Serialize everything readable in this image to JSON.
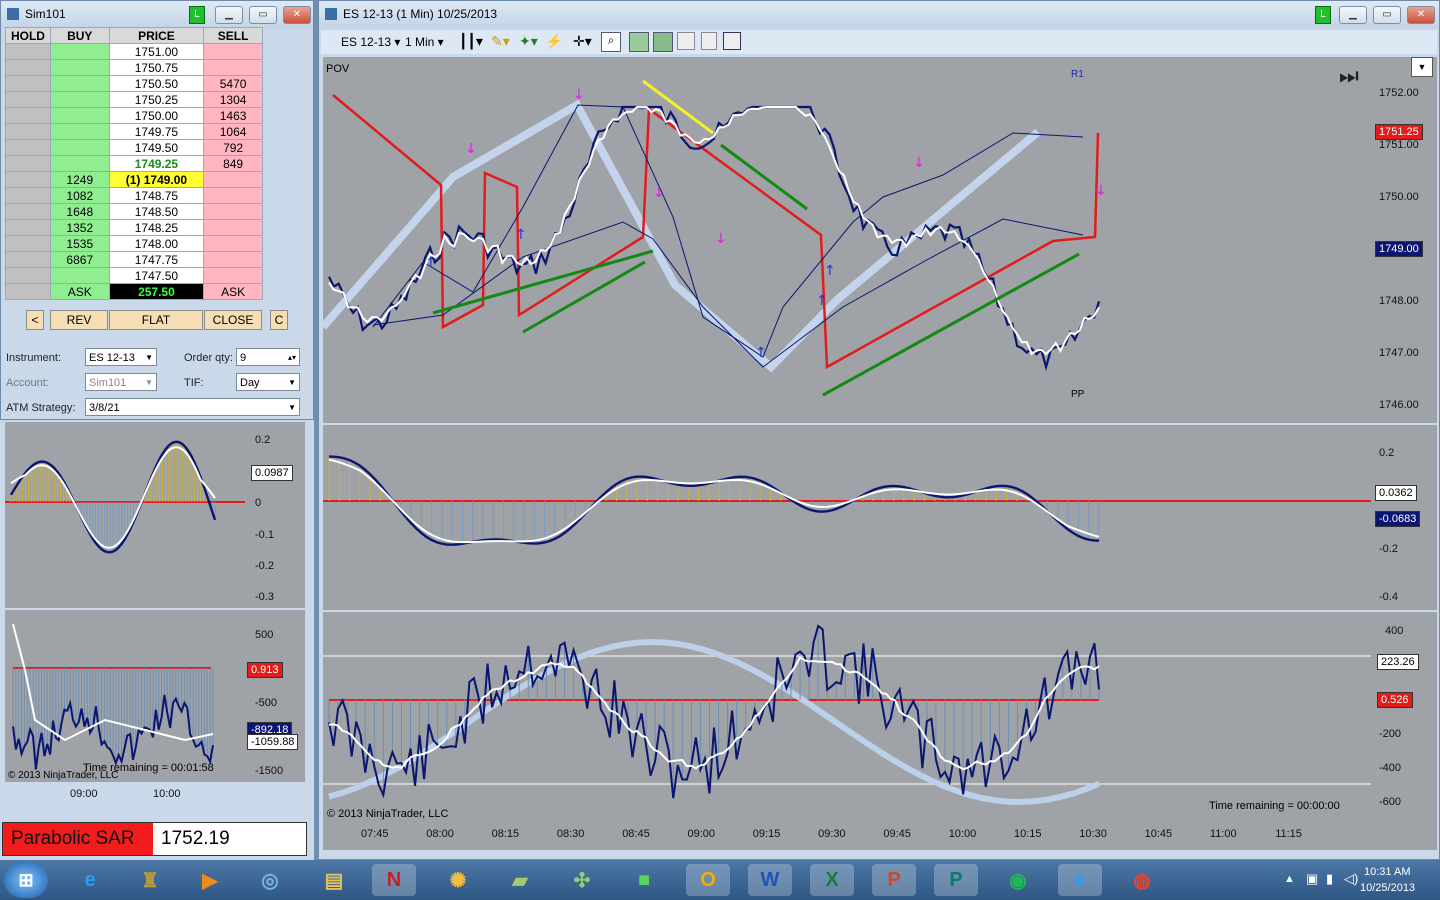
{
  "dom": {
    "title": "Sim101",
    "status_badge": "L",
    "headers": [
      "HOLD",
      "BUY",
      "PRICE",
      "SELL"
    ],
    "rows": [
      {
        "buy": "",
        "price": "1751.00",
        "sell": ""
      },
      {
        "buy": "",
        "price": "1750.75",
        "sell": ""
      },
      {
        "buy": "",
        "price": "1750.50",
        "sell": "5470"
      },
      {
        "buy": "",
        "price": "1750.25",
        "sell": "1304"
      },
      {
        "buy": "",
        "price": "1750.00",
        "sell": "1463"
      },
      {
        "buy": "",
        "price": "1749.75",
        "sell": "1064"
      },
      {
        "buy": "",
        "price": "1749.50",
        "sell": "792"
      },
      {
        "buy": "",
        "price": "1749.25",
        "sell": "849"
      },
      {
        "buy": "1249",
        "price": "(1) 1749.00",
        "sell": ""
      },
      {
        "buy": "1082",
        "price": "1748.75",
        "sell": ""
      },
      {
        "buy": "1648",
        "price": "1748.50",
        "sell": ""
      },
      {
        "buy": "1352",
        "price": "1748.25",
        "sell": ""
      },
      {
        "buy": "1535",
        "price": "1748.00",
        "sell": ""
      },
      {
        "buy": "6867",
        "price": "1747.75",
        "sell": ""
      },
      {
        "buy": "",
        "price": "1747.50",
        "sell": ""
      }
    ],
    "footer": {
      "left": "ASK",
      "mid": "257.50",
      "right": "ASK"
    },
    "buttons": {
      "back": "<",
      "rev": "REV",
      "flat": "FLAT",
      "close": "CLOSE",
      "c": "C"
    },
    "instrument_label": "Instrument:",
    "instrument_value": "ES 12-13",
    "order_qty_label": "Order qty:",
    "order_qty_value": "9",
    "account_label": "Account:",
    "account_value": "Sim101",
    "tif_label": "TIF:",
    "tif_value": "Day",
    "atm_label": "ATM Strategy:",
    "atm_value": "3/8/21"
  },
  "left_indicators": {
    "macd_ticks": [
      "0.2",
      "0.1",
      "0",
      "-0.1",
      "-0.2",
      "-0.3"
    ],
    "macd_tag": "0.0987",
    "osc_ticks": [
      "500",
      "-500",
      "-1500"
    ],
    "osc_tag_red": "0.913",
    "osc_tag1": "-892.18",
    "osc_tag2": "-1059.88",
    "time_remaining": "Time remaining = 00:01:58",
    "copyright": "© 2013 NinjaTrader, LLC",
    "x_ticks": [
      "09:00",
      "10:00"
    ]
  },
  "psar": {
    "label": "Parabolic SAR",
    "value": "1752.19"
  },
  "chart": {
    "title": "ES 12-13 (1 Min)  10/25/2013",
    "status_badge": "L",
    "toolbar_instrument": "ES 12-13",
    "toolbar_interval": "1 Min",
    "pov": "POV",
    "r1": "R1",
    "pp": "PP",
    "price_ticks": [
      "1752.00",
      "1751.00",
      "1750.00",
      "1749.00",
      "1748.00",
      "1747.00",
      "1746.00"
    ],
    "tag_last": "1751.25",
    "tag_current": "1749.00",
    "ind1_ticks": [
      "0.2",
      "0",
      "-0.2",
      "-0.4"
    ],
    "ind1_tag_white": "0.0362",
    "ind1_tag_navy": "-0.0683",
    "ind2_ticks": [
      "400",
      "200",
      "0",
      "-200",
      "-400",
      "-600"
    ],
    "ind2_tag_white": "223.26",
    "ind2_tag_red": "0.526",
    "time_ticks": [
      "07:45",
      "08:00",
      "08:15",
      "08:30",
      "08:45",
      "09:00",
      "09:15",
      "09:30",
      "09:45",
      "10:00",
      "10:15",
      "10:30",
      "10:45",
      "11:00",
      "11:15"
    ],
    "time_remaining": "Time remaining = 00:00:00",
    "copyright": "© 2013 NinjaTrader, LLC"
  },
  "taskbar": {
    "clock_time": "10:31 AM",
    "clock_date": "10/25/2013"
  },
  "colors": {
    "chart_bg": "#9fa2a6",
    "price_line": "#0a1670",
    "red": "#e21b1b",
    "buy_green": "#90ee90",
    "sell_pink": "#ffb6c1"
  }
}
